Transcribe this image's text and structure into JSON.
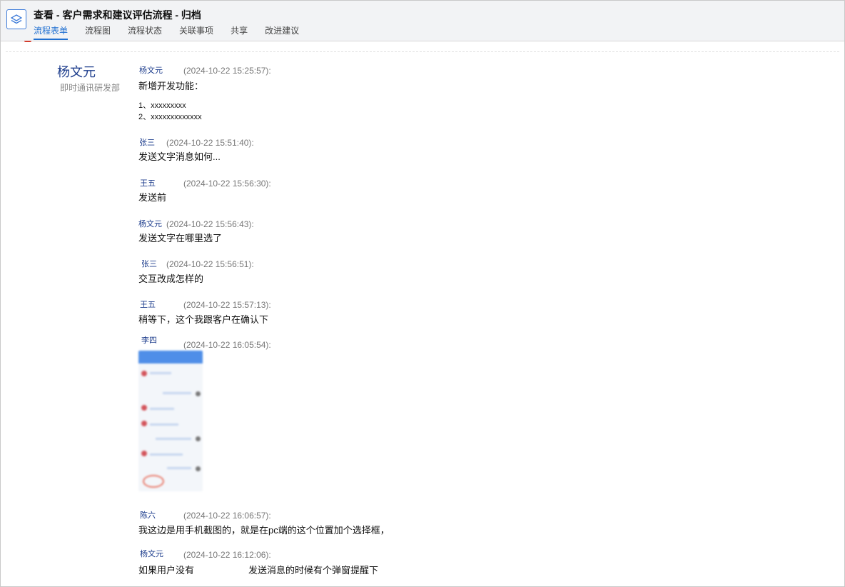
{
  "header": {
    "title": "查看 - 客户需求和建议评估流程 - 归档",
    "tabs": [
      {
        "label": "流程表单",
        "active": true
      },
      {
        "label": "流程图"
      },
      {
        "label": "流程状态"
      },
      {
        "label": "关联事项"
      },
      {
        "label": "共享"
      },
      {
        "label": "改进建议"
      }
    ]
  },
  "author": {
    "name": "杨文元",
    "dept": "即时通讯研发部"
  },
  "entries": [
    {
      "who": "杨文元",
      "time": "(2024-10-22 15:25:57):",
      "message": "新增开发功能：",
      "list": [
        "1、xxxxxxxxx",
        "2、xxxxxxxxxxxxx"
      ]
    },
    {
      "who": "张三",
      "time": "(2024-10-22 15:51:40):",
      "message": "发送文字消息如何..."
    },
    {
      "who": "王五",
      "time": "(2024-10-22 15:56:30):",
      "message": "发送前"
    },
    {
      "who": "杨文元",
      "time": "(2024-10-22 15:56:43):",
      "message": "发送文字在哪里选了"
    },
    {
      "who": "张三",
      "time": "(2024-10-22 15:56:51):",
      "message": "交互改成怎样的"
    },
    {
      "who": "王五",
      "time": "(2024-10-22 15:57:13):",
      "message": "稍等下，这个我跟客户在确认下"
    },
    {
      "who": "李四",
      "time": "(2024-10-22 16:05:54):",
      "message": ""
    },
    {
      "who": "陈六",
      "time": "(2024-10-22 16:06:57):",
      "message": "我这边是用手机截图的，就是在pc端的这个位置加个选择框，"
    },
    {
      "who": "杨文元",
      "time": "(2024-10-22 16:12:06):",
      "message_a": "如果用户没有",
      "message_b": "发送消息的时候有个弹窗提醒下"
    }
  ],
  "colors": {
    "accent": "#1f6fd1",
    "name_blue": "#1c3c8c"
  },
  "icons": {
    "app": "layers-icon"
  }
}
